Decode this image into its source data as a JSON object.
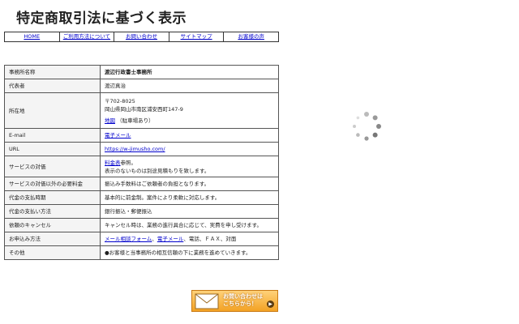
{
  "page": {
    "title": "特定商取引法に基づく表示"
  },
  "nav": {
    "items": [
      "HOME",
      "ご利用方法について",
      "お問い合わせ",
      "サイトマップ",
      "お客様の声"
    ]
  },
  "info": {
    "rows": [
      {
        "key": "事務所名称",
        "value": "渡辺行政書士事務所"
      },
      {
        "key": "代表者",
        "value": "渡辺真治"
      },
      {
        "key": "所在地",
        "postal": "〒702-8025",
        "address": "岡山県岡山市南区浦安西町147-9",
        "map_link": "地図",
        "parking": "（駐車場あり）"
      },
      {
        "key": "E-mail",
        "link": "電子メール"
      },
      {
        "key": "URL",
        "link": "https://w-jimusho.com/"
      },
      {
        "key": "サービスの対価",
        "link": "料金表",
        "suffix": "参照。",
        "line2": "表示のないものは別途見積もりを致します。"
      },
      {
        "key": "サービスの対価以外の必要料金",
        "value": "振込み手数料はご依頼者の負担となります。"
      },
      {
        "key": "代金の支払時期",
        "value": "基本的に前金制。案件により柔軟に対応します。"
      },
      {
        "key": "代金の支払い方法",
        "value": "銀行振込・郵便振込"
      },
      {
        "key": "依頼のキャンセル",
        "value": "キャンセル時は、業務の進行具合に応じて、実費を申し受けます。"
      },
      {
        "key": "お申込み方法",
        "link1": "メール相談フォーム",
        "sep": "、",
        "link2": "電子メール",
        "rest": "、電話、ＦＡＸ、対面"
      },
      {
        "key": "その他",
        "value": "●お客様と当事務所の相互信頼の下に業務を進めていきます。"
      }
    ]
  },
  "banner": {
    "line1": "お問い合わせは",
    "line2": "こちらから！"
  },
  "spinner": {
    "icon": "loading-spinner-icon"
  },
  "colors": {
    "link": "#0000cc",
    "banner": "#f3a224"
  }
}
